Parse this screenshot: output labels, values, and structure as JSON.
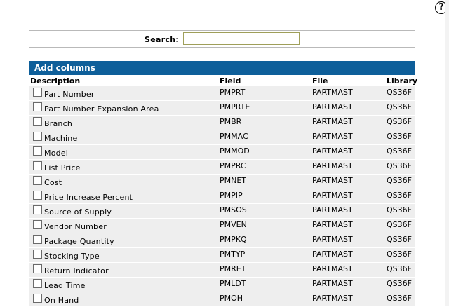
{
  "help": {
    "icon": "question-mark-icon",
    "glyph": "?"
  },
  "search": {
    "label": "Search:",
    "value": "",
    "placeholder": ""
  },
  "panel": {
    "title": "Add columns"
  },
  "columns": {
    "description": "Description",
    "field": "Field",
    "file": "File",
    "library": "Library"
  },
  "rows": [
    {
      "description": "Part Number",
      "field": "PMPRT",
      "file": "PARTMAST",
      "library": "QS36F",
      "checked": false
    },
    {
      "description": "Part Number Expansion Area",
      "field": "PMPRTE",
      "file": "PARTMAST",
      "library": "QS36F",
      "checked": false
    },
    {
      "description": "Branch",
      "field": "PMBR",
      "file": "PARTMAST",
      "library": "QS36F",
      "checked": false
    },
    {
      "description": "Machine",
      "field": "PMMAC",
      "file": "PARTMAST",
      "library": "QS36F",
      "checked": false
    },
    {
      "description": "Model",
      "field": "PMMOD",
      "file": "PARTMAST",
      "library": "QS36F",
      "checked": false
    },
    {
      "description": "List Price",
      "field": "PMPRC",
      "file": "PARTMAST",
      "library": "QS36F",
      "checked": false
    },
    {
      "description": "Cost",
      "field": "PMNET",
      "file": "PARTMAST",
      "library": "QS36F",
      "checked": false
    },
    {
      "description": "Price Increase Percent",
      "field": "PMPIP",
      "file": "PARTMAST",
      "library": "QS36F",
      "checked": false
    },
    {
      "description": "Source of Supply",
      "field": "PMSOS",
      "file": "PARTMAST",
      "library": "QS36F",
      "checked": false
    },
    {
      "description": "Vendor Number",
      "field": "PMVEN",
      "file": "PARTMAST",
      "library": "QS36F",
      "checked": false
    },
    {
      "description": "Package Quantity",
      "field": "PMPKQ",
      "file": "PARTMAST",
      "library": "QS36F",
      "checked": false
    },
    {
      "description": "Stocking Type",
      "field": "PMTYP",
      "file": "PARTMAST",
      "library": "QS36F",
      "checked": false
    },
    {
      "description": "Return Indicator",
      "field": "PMRET",
      "file": "PARTMAST",
      "library": "QS36F",
      "checked": false
    },
    {
      "description": "Lead Time",
      "field": "PMLDT",
      "file": "PARTMAST",
      "library": "QS36F",
      "checked": false
    },
    {
      "description": "On Hand",
      "field": "PMOH",
      "file": "PARTMAST",
      "library": "QS36F",
      "checked": false
    }
  ],
  "colors": {
    "header_bg": "#0e5f9a",
    "row_bg": "#eeeeee",
    "input_border": "#9f9f5a"
  }
}
